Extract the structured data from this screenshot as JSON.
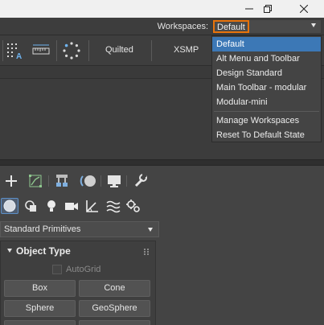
{
  "window": {
    "controls": {
      "minimize_icon": "minimize-icon",
      "restore_icon": "restore-icon",
      "close_icon": "close-icon"
    }
  },
  "workspaces": {
    "label": "Workspaces:",
    "selected": "Default",
    "accent_color": "#e8730b"
  },
  "workspace_menu": {
    "items": [
      "Default",
      "Alt Menu and Toolbar",
      "Design Standard",
      "Main Toolbar - modular",
      "Modular-mini"
    ],
    "actions": [
      "Manage Workspaces",
      "Reset To Default State"
    ],
    "highlight_color": "#3c78b6"
  },
  "ribbon": {
    "icons": [
      "snap-grid-icon",
      "measure-icon",
      "dotted-circle-icon"
    ],
    "tabs": [
      "Quilted",
      "XSMP"
    ]
  },
  "command_panel": {
    "tab_icons": [
      "create-icon",
      "modify-icon",
      "hierarchy-icon",
      "motion-icon",
      "display-icon",
      "utilities-icon"
    ],
    "category_icons": [
      "geometry-icon",
      "shapes-icon",
      "lights-icon",
      "cameras-icon",
      "helpers-icon",
      "space-warps-icon",
      "systems-icon"
    ],
    "dropdown_value": "Standard Primitives"
  },
  "object_type": {
    "title": "Object Type",
    "autogrid_label": "AutoGrid",
    "buttons": [
      "Box",
      "Cone",
      "Sphere",
      "GeoSphere"
    ]
  }
}
